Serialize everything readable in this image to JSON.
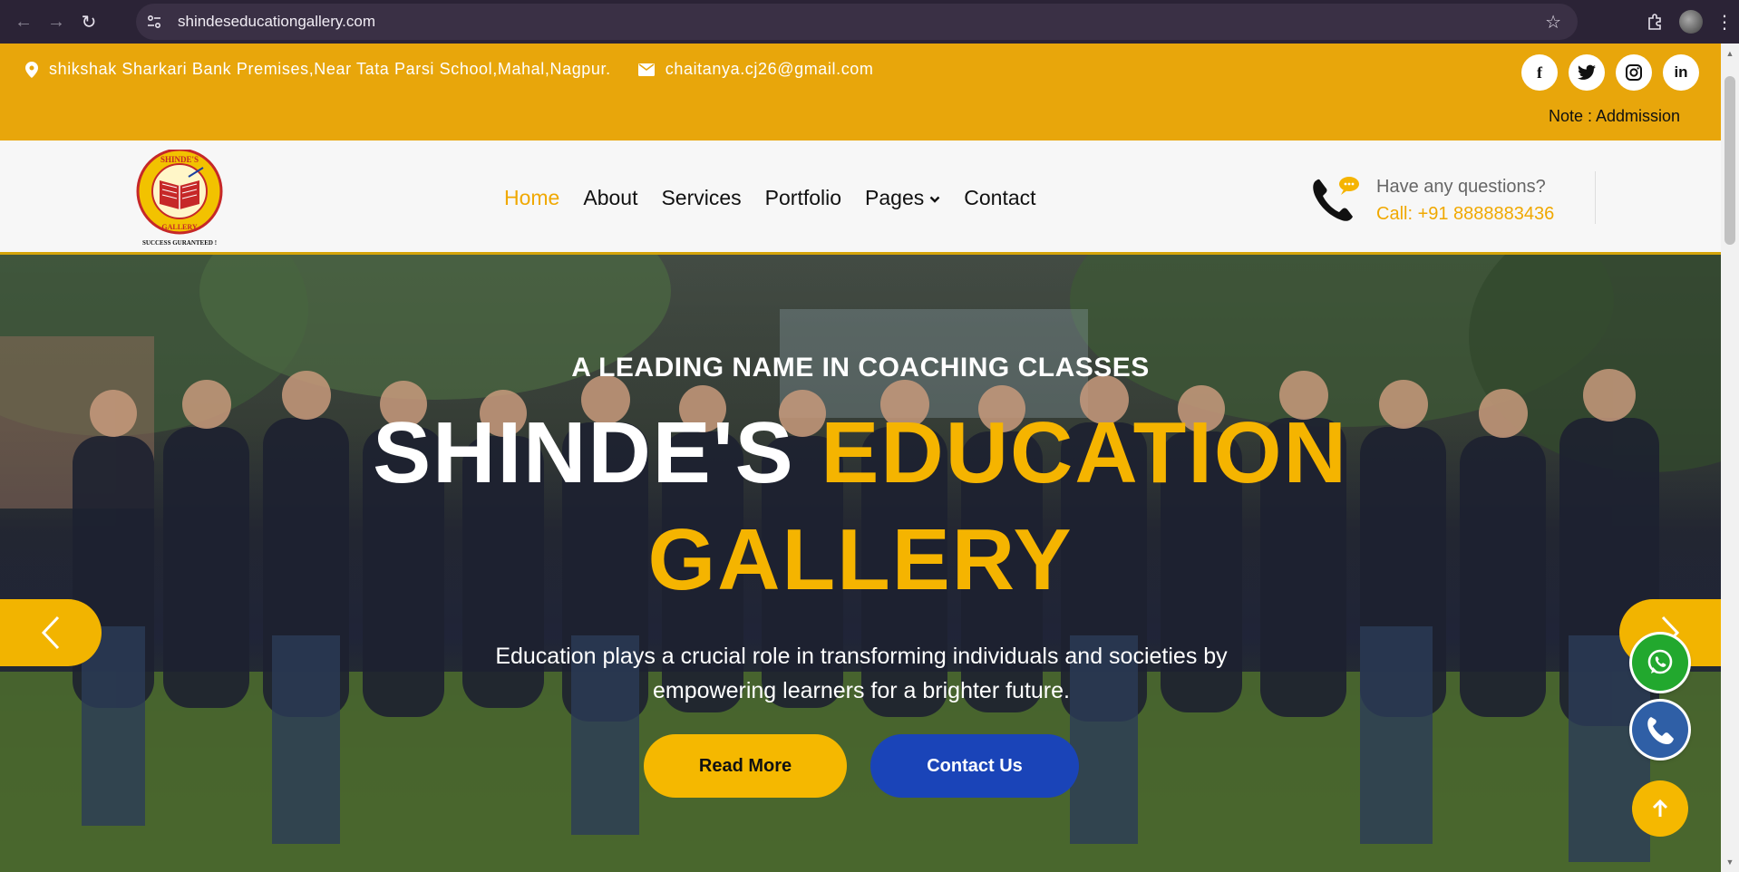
{
  "browser": {
    "url": "shindeseducationgallery.com",
    "icons": [
      "back-arrow-icon",
      "forward-arrow-icon",
      "reload-icon",
      "site-info-icon",
      "star-icon",
      "extensions-icon",
      "profile-avatar",
      "menu-kebab-icon"
    ]
  },
  "topbar": {
    "address": "shikshak Sharkari Bank Premises,Near Tata Parsi School,Mahal,Nagpur.",
    "email": "chaitanya.cj26@gmail.com",
    "marquee": "Note : Addmission",
    "socials": [
      "f",
      "t",
      "ig",
      "in"
    ]
  },
  "header": {
    "logo_text_ring": "SHINDE'S EDUCATION GALLERY",
    "logo_tagline": "SUCCESS GURANTEED !",
    "menu": [
      "Home",
      "About",
      "Services",
      "Portfolio",
      "Pages",
      "Contact"
    ],
    "help_question": "Have any questions?",
    "help_call": "Call: +91 8888883436"
  },
  "hero": {
    "subtitle": "A LEADING NAME IN COACHING CLASSES",
    "title_white": "SHINDE'S",
    "title_yellow_1": "EDUCATION",
    "title_yellow_2": "GALLERY",
    "text": "Education plays a crucial role in transforming individuals and societies by empowering learners for a brighter future.",
    "read_more": "Read More",
    "contact_us": "Contact Us"
  },
  "colors": {
    "topbar": "#e8a60b",
    "accent": "#f5b400",
    "button_blue": "#1a44b8",
    "whatsapp": "#22a82e",
    "call": "#2f5fa6"
  }
}
